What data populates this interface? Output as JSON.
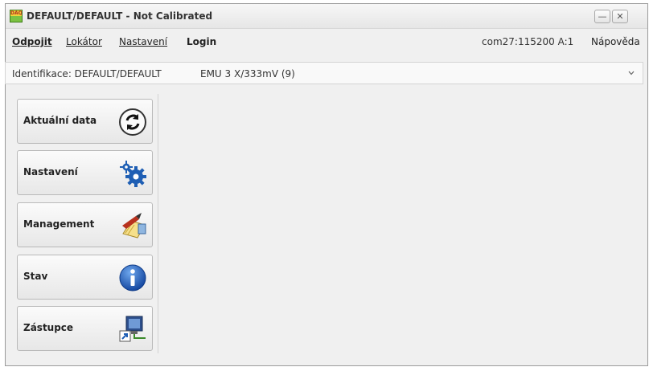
{
  "window": {
    "title": "DEFAULT/DEFAULT - Not Calibrated",
    "app_icon_text": "DAQ",
    "minimize_glyph": "—",
    "close_glyph": "✕"
  },
  "menu": {
    "odpojit": "Odpojit",
    "lokator": "Lokátor",
    "nastaveni": "Nastavení",
    "login": "Login",
    "connection": "com27:115200 A:1",
    "help": "Nápověda"
  },
  "identification": {
    "label": "Identifikace: DEFAULT/DEFAULT",
    "device": "EMU 3 X/333mV (9)"
  },
  "nav": [
    {
      "label": "Aktuální data",
      "icon": "refresh-icon"
    },
    {
      "label": "Nastavení",
      "icon": "gears-icon"
    },
    {
      "label": "Management",
      "icon": "management-icon"
    },
    {
      "label": "Stav",
      "icon": "info-icon"
    },
    {
      "label": "Zástupce",
      "icon": "shortcut-icon"
    }
  ],
  "colors": {
    "accent_blue": "#1f5fb4",
    "titlebar": "#e9e9e9"
  }
}
